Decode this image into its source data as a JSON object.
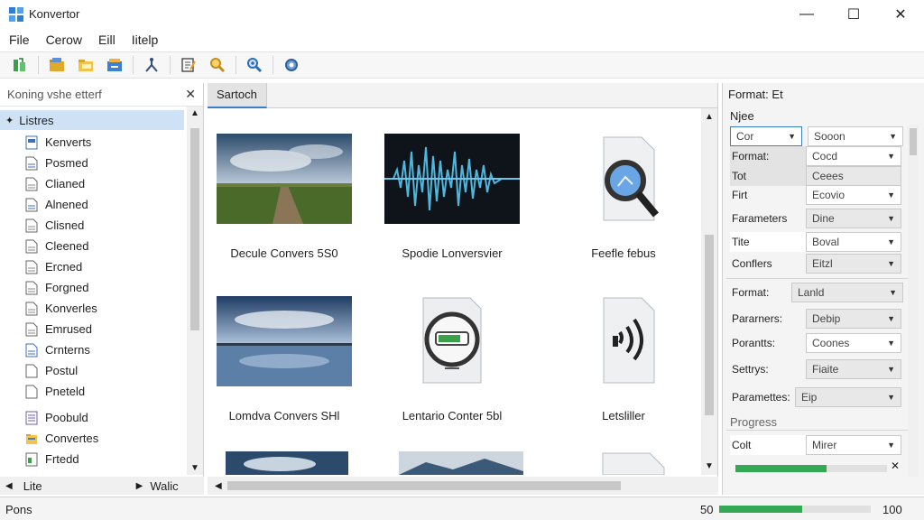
{
  "window": {
    "title": "Konvertor",
    "minimize": "—",
    "maximize": "☐",
    "close": "✕"
  },
  "menu": [
    "File",
    "Cerow",
    "Eill",
    "Iitelp"
  ],
  "toolbar": {
    "icons": [
      "new-icon",
      "open-icon",
      "folder-icon",
      "export-icon",
      "split-icon",
      "edit-icon",
      "search-icon",
      "zoom-icon",
      "settings-icon"
    ]
  },
  "left_panel": {
    "header": "Koning vshe etterf",
    "close": "✕",
    "root": "Listres",
    "root_marker": "✦",
    "items": [
      "Kenverts",
      "Posmed",
      "Clianed",
      "Alnened",
      "Clisned",
      "Cleened",
      "Ercned",
      "Forgned",
      "Konverles",
      "Emrused",
      "Crnterns",
      "Postul",
      "Pneteld",
      "Poobuld",
      "Convertes",
      "Frtedd"
    ],
    "footer_left": "Lite",
    "footer_right": "Walic"
  },
  "center_panel": {
    "tab": "Sartoch",
    "items": [
      {
        "label": "Decule Convers 5S0",
        "kind": "landscape-road"
      },
      {
        "label": "Spodie Lonversvier",
        "kind": "waveform"
      },
      {
        "label": "Feefle febus",
        "kind": "file-search"
      },
      {
        "label": "Lomdva Convers SHl",
        "kind": "landscape-lake"
      },
      {
        "label": "Lentario Conter 5bl",
        "kind": "device"
      },
      {
        "label": "Letsliller",
        "kind": "file-audio"
      }
    ]
  },
  "right_panel": {
    "header": "Format: Et",
    "sub": "Njee",
    "rows": [
      {
        "label_value": "Cor",
        "value": "Sooon",
        "first_select": true
      },
      {
        "label": "Format:",
        "value": "Cocd"
      },
      {
        "label": "Tot",
        "value": "Ceees"
      },
      {
        "label": "Firt",
        "value": "Ecovio"
      },
      {
        "label": "Farameters",
        "value": "Dine"
      },
      {
        "label": "Tite",
        "value": "Boval"
      },
      {
        "label": "Conflers",
        "value": "Eitzl"
      },
      {
        "label": "Format:",
        "value": "Lanld"
      },
      {
        "label": "Pararners:",
        "value": "Debip"
      },
      {
        "label": "Porantts:",
        "value": "Coones"
      },
      {
        "label": "Settrys:",
        "value": "Fiaite"
      },
      {
        "label": "Paramettes:",
        "value": "Eip"
      }
    ],
    "progress_label": "Progress",
    "progress_row": {
      "label": "Colt",
      "value": "Mirer"
    },
    "progress": 0.6,
    "progress_end": "✕"
  },
  "status": {
    "left": "Pons",
    "min": "50",
    "max": "100",
    "progress": 0.55
  },
  "colors": {
    "accent": "#3c7fc4",
    "selection": "#cfe1f5",
    "progress": "#34a853"
  }
}
